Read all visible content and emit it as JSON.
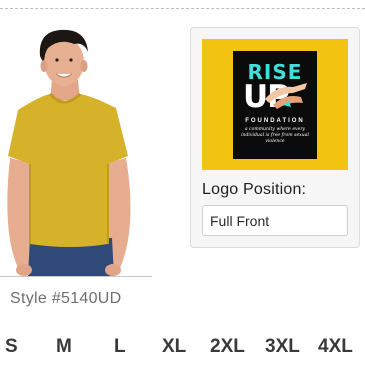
{
  "product": {
    "style_label": "Style #5140UD"
  },
  "logo": {
    "title_line1": "RISE",
    "title_line2": "UP",
    "org_line": "FOUNDATION",
    "tagline": "a community where every individual is free from sexual violence",
    "background_color": "#f2c411",
    "art_background_color": "#0b0b0b",
    "accent_color": "#3fe0da"
  },
  "logo_position": {
    "label": "Logo Position:",
    "selected_value": "Full Front"
  },
  "sizes": [
    "S",
    "M",
    "L",
    "XL",
    "2XL",
    "3XL",
    "4XL"
  ],
  "shirt_color": "#d6b12a"
}
